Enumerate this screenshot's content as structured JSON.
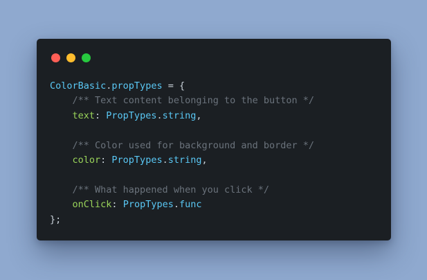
{
  "window": {
    "controls": [
      {
        "name": "close",
        "color": "#ff5f56"
      },
      {
        "name": "minimize",
        "color": "#ffbd2e"
      },
      {
        "name": "maximize",
        "color": "#27c93f"
      }
    ]
  },
  "code": {
    "line1": {
      "object": "ColorBasic",
      "dot": ".",
      "member": "propTypes",
      "rest": " = {"
    },
    "line2": {
      "indent": "    ",
      "comment": "/** Text content belonging to the button */"
    },
    "line3": {
      "indent": "    ",
      "key": "text",
      "colon": ": ",
      "type_obj": "PropTypes",
      "dot": ".",
      "type": "string",
      "tail": ","
    },
    "line5": {
      "indent": "    ",
      "comment": "/** Color used for background and border */"
    },
    "line6": {
      "indent": "    ",
      "key": "color",
      "colon": ": ",
      "type_obj": "PropTypes",
      "dot": ".",
      "type": "string",
      "tail": ","
    },
    "line8": {
      "indent": "    ",
      "comment": "/** What happened when you click */"
    },
    "line9": {
      "indent": "    ",
      "key": "onClick",
      "colon": ": ",
      "type_obj": "PropTypes",
      "dot": ".",
      "type": "func",
      "tail": ""
    },
    "line10": {
      "close": "};"
    }
  },
  "colors": {
    "background": "#8fa9cf",
    "editor": "#1b1f23",
    "identifier": "#5ac8f5",
    "property": "#9ad45a",
    "comment": "#6b737c",
    "text": "#c9d1d9"
  }
}
